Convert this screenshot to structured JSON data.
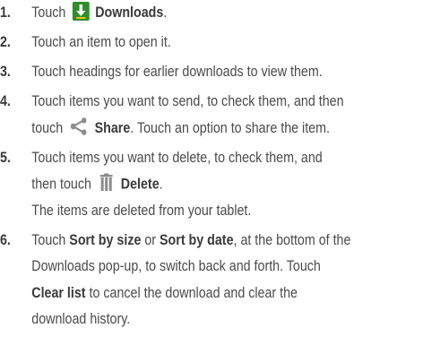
{
  "steps": [
    {
      "num": "1.",
      "lines": [
        {
          "parts": [
            {
              "t": "Touch "
            },
            {
              "icon": "download-icon"
            },
            {
              "t": " Downloads",
              "b": true
            },
            {
              "t": "."
            }
          ]
        }
      ]
    },
    {
      "num": "2.",
      "lines": [
        {
          "parts": [
            {
              "t": "Touch an item to open it."
            }
          ]
        }
      ]
    },
    {
      "num": "3.",
      "lines": [
        {
          "parts": [
            {
              "t": "Touch headings for earlier downloads to view them."
            }
          ]
        }
      ]
    },
    {
      "num": "4.",
      "lines": [
        {
          "parts": [
            {
              "t": "Touch items you want to send, to check them, and then"
            }
          ]
        },
        {
          "parts": [
            {
              "t": "touch "
            },
            {
              "icon": "share-icon"
            },
            {
              "t": " Share",
              "b": true
            },
            {
              "t": ". Touch an option to share the item."
            }
          ]
        }
      ]
    },
    {
      "num": "5.",
      "lines": [
        {
          "parts": [
            {
              "t": "Touch items you want to delete, to check them, and"
            }
          ]
        },
        {
          "parts": [
            {
              "t": "then touch "
            },
            {
              "icon": "trash-icon"
            },
            {
              "t": " Delete",
              "b": true
            },
            {
              "t": "."
            }
          ]
        },
        {
          "parts": [
            {
              "t": "The items are deleted from your tablet."
            }
          ]
        }
      ]
    },
    {
      "num": "6.",
      "lines": [
        {
          "parts": [
            {
              "t": "Touch "
            },
            {
              "t": "Sort by size",
              "b": true
            },
            {
              "t": " or "
            },
            {
              "t": "Sort by date",
              "b": true
            },
            {
              "t": ", at the bottom of the"
            }
          ]
        },
        {
          "parts": [
            {
              "t": "Downloads pop-up, to switch back and forth. Touch"
            }
          ]
        },
        {
          "parts": [
            {
              "t": "Clear list",
              "b": true
            },
            {
              "t": " to cancel the download and clear the"
            }
          ]
        },
        {
          "parts": [
            {
              "t": "download history."
            }
          ]
        }
      ]
    }
  ],
  "colors": {
    "text": "#4a4a4a",
    "download_icon_bg": "#2f8e2a",
    "icon_gray": "#8c8c8c"
  }
}
